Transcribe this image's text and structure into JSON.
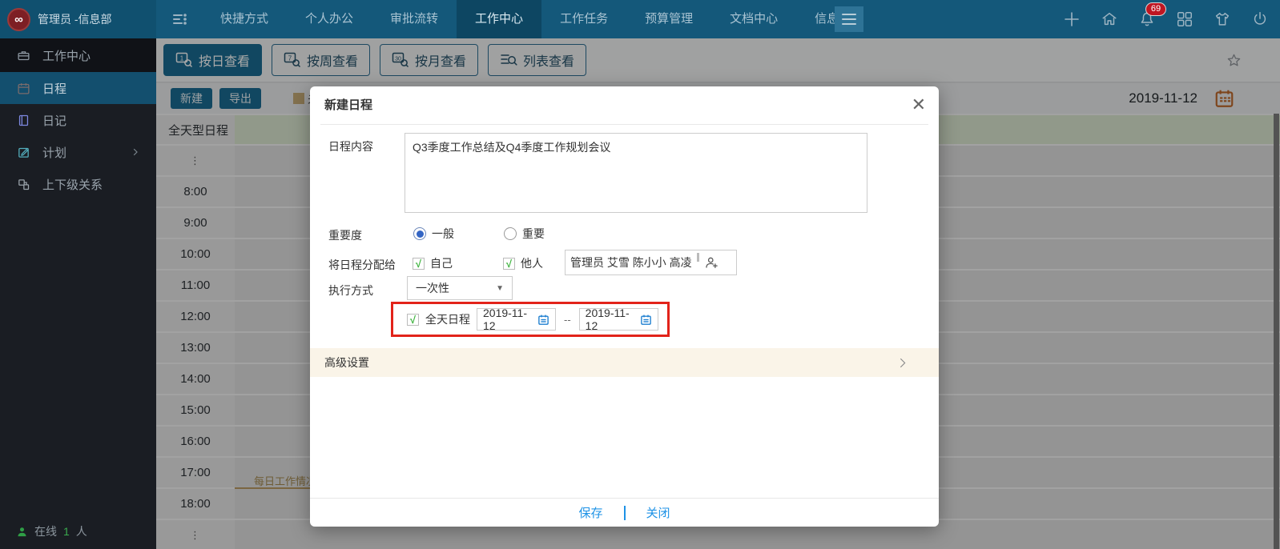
{
  "topbar": {
    "logo_text": "∞",
    "user_title": "管理员 -信息部",
    "nav": [
      {
        "label": "快捷方式",
        "active": false
      },
      {
        "label": "个人办公",
        "active": false
      },
      {
        "label": "审批流转",
        "active": false
      },
      {
        "label": "工作中心",
        "active": true
      },
      {
        "label": "工作任务",
        "active": false
      },
      {
        "label": "预算管理",
        "active": false
      },
      {
        "label": "文档中心",
        "active": false
      },
      {
        "label": "信息发布",
        "active": false
      }
    ],
    "notification_count": "69"
  },
  "sidebar": {
    "items": [
      {
        "label": "工作中心"
      },
      {
        "label": "日程"
      },
      {
        "label": "日记"
      },
      {
        "label": "计划"
      },
      {
        "label": "上下级关系"
      }
    ],
    "online": {
      "prefix": "在线",
      "count": "1",
      "suffix": "人"
    }
  },
  "toolbar": {
    "view_buttons": [
      {
        "label": "按日查看",
        "badge": "1"
      },
      {
        "label": "按周查看",
        "badge": "7"
      },
      {
        "label": "按月查看",
        "badge": "30"
      },
      {
        "label": "列表查看",
        "badge": ""
      }
    ]
  },
  "actionbar": {
    "new_label": "新建",
    "export_label": "导出",
    "legend_label": "未",
    "date": "2019-11-12"
  },
  "calendar": {
    "allday_label": "全天型日程",
    "ellipsis": "⋮",
    "times": [
      "8:00",
      "9:00",
      "10:00",
      "11:00",
      "12:00",
      "13:00",
      "14:00",
      "15:00",
      "16:00",
      "17:00",
      "18:00"
    ],
    "event_title": "每日工作情况总"
  },
  "modal": {
    "title": "新建日程",
    "close_glyph": "✕",
    "content_label": "日程内容",
    "content_value": "Q3季度工作总结及Q4季度工作规划会议",
    "importance_label": "重要度",
    "importance_options": [
      {
        "label": "一般",
        "selected": true
      },
      {
        "label": "重要",
        "selected": false
      }
    ],
    "assign_label": "将日程分配给",
    "assign_options": [
      {
        "label": "自己",
        "checked": true
      },
      {
        "label": "他人",
        "checked": true
      }
    ],
    "check_glyph": "√",
    "assignees": "管理员  艾雪  陈小小  高凌",
    "mode_label": "执行方式",
    "mode_value": "一次性",
    "mode_caret": "▼",
    "allday_label": "全天日程",
    "date_start": "2019-11-12",
    "date_end": "2019-11-12",
    "range_sep": "--",
    "advanced_label": "高级设置",
    "footer": {
      "save": "保存",
      "close": "关闭"
    }
  }
}
